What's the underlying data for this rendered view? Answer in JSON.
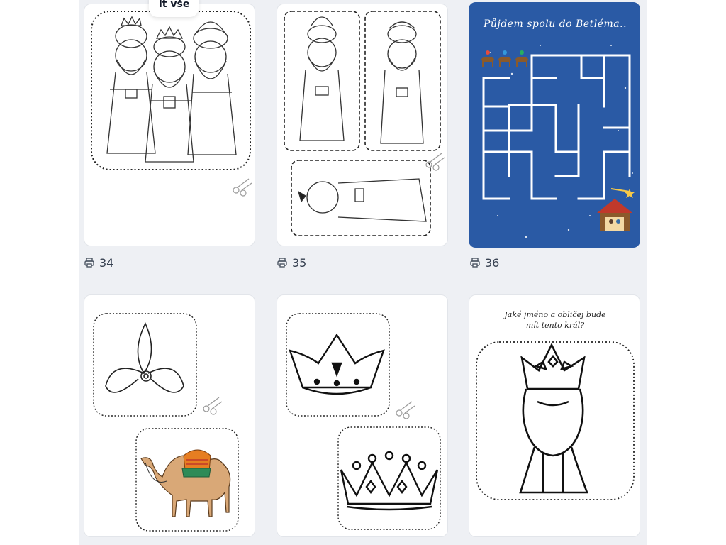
{
  "header": {
    "select_all_label": "it vše"
  },
  "cards": [
    {
      "id": "card-34",
      "print_count": "34",
      "printer_icon": "printer-icon",
      "content": "three-kings-coloring"
    },
    {
      "id": "card-35",
      "print_count": "35",
      "printer_icon": "printer-icon",
      "content": "kings-cutout"
    },
    {
      "id": "card-36",
      "print_count": "36",
      "printer_icon": "printer-icon",
      "content": "bethlehem-maze",
      "title": "Půjdem spolu do Betléma..",
      "bg_color": "#2a5aa5"
    },
    {
      "id": "card-37",
      "content": "turban-and-camel-cutout"
    },
    {
      "id": "card-38",
      "content": "crowns-cutout"
    },
    {
      "id": "card-39",
      "content": "king-face-drawing",
      "prompt_line1": "Jaké jméno a obličej bude",
      "prompt_line2": "mít tento král?"
    }
  ]
}
